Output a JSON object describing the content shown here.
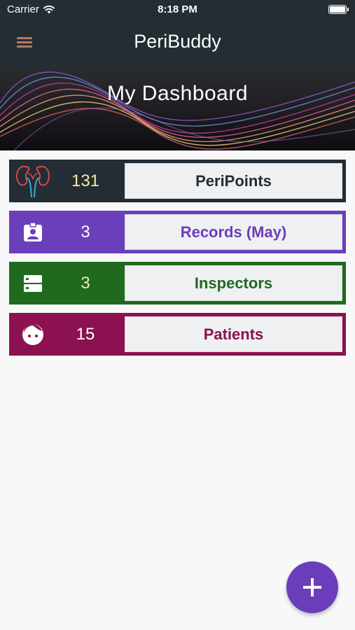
{
  "status_bar": {
    "carrier": "Carrier",
    "time": "8:18 PM"
  },
  "header": {
    "title": "PeriBuddy",
    "menu_icon": "hamburger-menu-icon"
  },
  "hero": {
    "title": "My Dashboard"
  },
  "cards": [
    {
      "icon": "kidney-icon",
      "count": "131",
      "label": "PeriPoints",
      "bg": "#232d33",
      "count_color": "#f5eba4",
      "label_color": "#232d33"
    },
    {
      "icon": "id-badge-icon",
      "count": "3",
      "label": "Records (May)",
      "bg": "#6b3ebb",
      "count_color": "#ffffff",
      "label_color": "#6b3ebb"
    },
    {
      "icon": "storage-icon",
      "count": "3",
      "label": "Inspectors",
      "bg": "#1f6a1f",
      "count_color": "#f5eba4",
      "label_color": "#1f6a1f"
    },
    {
      "icon": "child-face-icon",
      "count": "15",
      "label": "Patients",
      "bg": "#8b1150",
      "count_color": "#ffffff",
      "label_color": "#8b1150"
    }
  ],
  "fab": {
    "icon": "plus-icon",
    "color": "#6a3eba"
  }
}
